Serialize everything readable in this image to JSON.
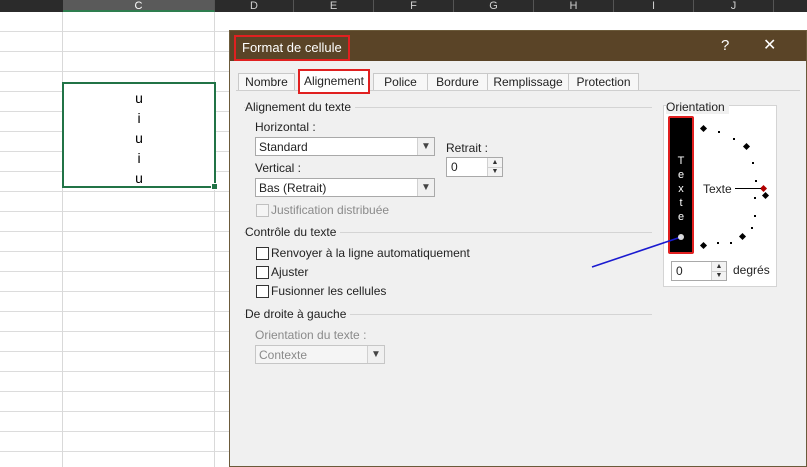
{
  "spreadsheet": {
    "columns": [
      "C",
      "D",
      "E",
      "F",
      "G",
      "H",
      "I",
      "J"
    ],
    "selected_column": "C",
    "cell_lines": [
      "u",
      "i",
      "u",
      "i",
      "u"
    ]
  },
  "dialog": {
    "title": "Format de cellule",
    "help_label": "?",
    "close_label": "✕",
    "tabs": [
      "Nombre",
      "Alignement",
      "Police",
      "Bordure",
      "Remplissage",
      "Protection"
    ],
    "active_tab": "Alignement",
    "alignment": {
      "group_label": "Alignement du texte",
      "horizontal_label": "Horizontal :",
      "horizontal_value": "Standard",
      "vertical_label": "Vertical :",
      "vertical_value": "Bas (Retrait)",
      "indent_label": "Retrait :",
      "indent_value": "0",
      "justify_distributed": "Justification distribuée"
    },
    "text_control": {
      "group_label": "Contrôle du texte",
      "wrap": "Renvoyer à la ligne automatiquement",
      "shrink": "Ajuster",
      "merge": "Fusionner les cellules"
    },
    "rtl": {
      "group_label": "De droite à gauche",
      "direction_label": "Orientation du texte :",
      "direction_value": "Contexte"
    },
    "orientation": {
      "group_label": "Orientation",
      "vertical_text": "Texte",
      "dial_label": "Texte",
      "degrees_value": "0",
      "degrees_label": "degrés"
    }
  },
  "colors": {
    "title_bar": "#5a4427",
    "highlight_red": "#e02020",
    "excel_green": "#217346",
    "arrow_blue": "#1a1ad0"
  }
}
